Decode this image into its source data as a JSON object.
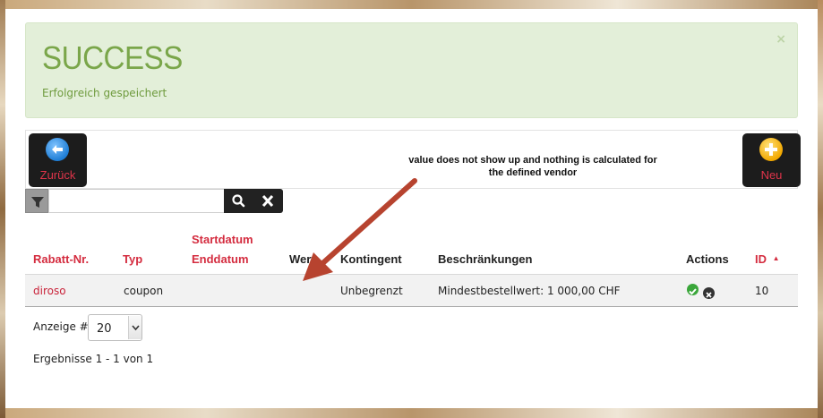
{
  "alert": {
    "title": "SUCCESS",
    "message": "Erfolgreich gespeichert",
    "close_glyph": "×"
  },
  "toolbar": {
    "back_label": "Zurück",
    "new_label": "Neu"
  },
  "annotation": {
    "line1": "value does not show up and nothing is calculated for",
    "line2": "the defined vendor"
  },
  "filter": {
    "value": "",
    "placeholder": ""
  },
  "table": {
    "headers": {
      "rabatt_nr": "Rabatt-Nr.",
      "typ": "Typ",
      "startdatum": "Startdatum",
      "enddatum": "Enddatum",
      "wert": "Wert",
      "kontingent": "Kontingent",
      "beschraenkungen": "Beschränkungen",
      "actions": "Actions",
      "id": "ID",
      "id_sort_glyph": "▲"
    },
    "rows": [
      {
        "rabatt_nr": "diroso",
        "typ": "coupon",
        "startdatum": "",
        "enddatum": "",
        "wert": "",
        "kontingent": "Unbegrenzt",
        "beschraenkungen": "Mindestbestellwert: 1 000,00 CHF",
        "id": "10"
      }
    ]
  },
  "pagination": {
    "show_label": "Anzeige #",
    "page_size": "20",
    "results_text": "Ergebnisse 1 - 1 von 1"
  },
  "colors": {
    "accent_red": "#d42c3f",
    "success_green": "#7aa64a",
    "annotation_arrow": "#b7432f"
  }
}
